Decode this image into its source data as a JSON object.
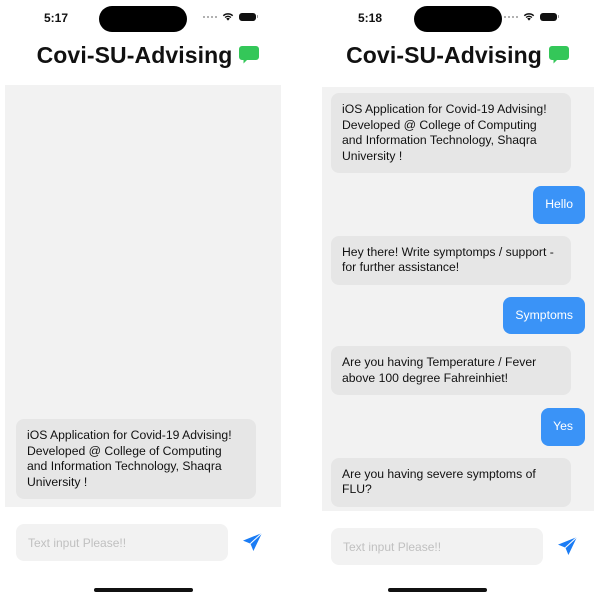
{
  "app": {
    "title": "Covi-SU-Advising",
    "title_icon": "message-bubble-icon",
    "accent_color": "#34c759",
    "user_bubble_color": "#3a93f7",
    "bot_bubble_color": "#e6e6e6",
    "send_icon_color": "#1a7cf5"
  },
  "screens": [
    {
      "status_bar": {
        "time": "5:17"
      },
      "messages": [
        {
          "sender": "bot",
          "text": "iOS Application for Covid-19 Advising! Developed @ College of Computing and Information Technology, Shaqra University !"
        }
      ],
      "input": {
        "value": "",
        "placeholder": "Text input Please!!"
      },
      "send_icon": "paper-plane-icon"
    },
    {
      "status_bar": {
        "time": "5:18"
      },
      "messages": [
        {
          "sender": "bot",
          "text": "iOS Application for Covid-19 Advising! Developed @ College of Computing and Information Technology, Shaqra University !"
        },
        {
          "sender": "user",
          "text": "Hello"
        },
        {
          "sender": "bot",
          "text": "Hey there! Write symptomps / support - for further assistance!"
        },
        {
          "sender": "user",
          "text": "Symptoms"
        },
        {
          "sender": "bot",
          "text": "Are you having Temperature / Fever above 100 degree Fahreinhiet!"
        },
        {
          "sender": "user",
          "text": "Yes"
        },
        {
          "sender": "bot",
          "text": "Are you having severe symptoms of FLU?"
        }
      ],
      "input": {
        "value": "",
        "placeholder": "Text input Please!!"
      },
      "send_icon": "paper-plane-icon"
    }
  ]
}
